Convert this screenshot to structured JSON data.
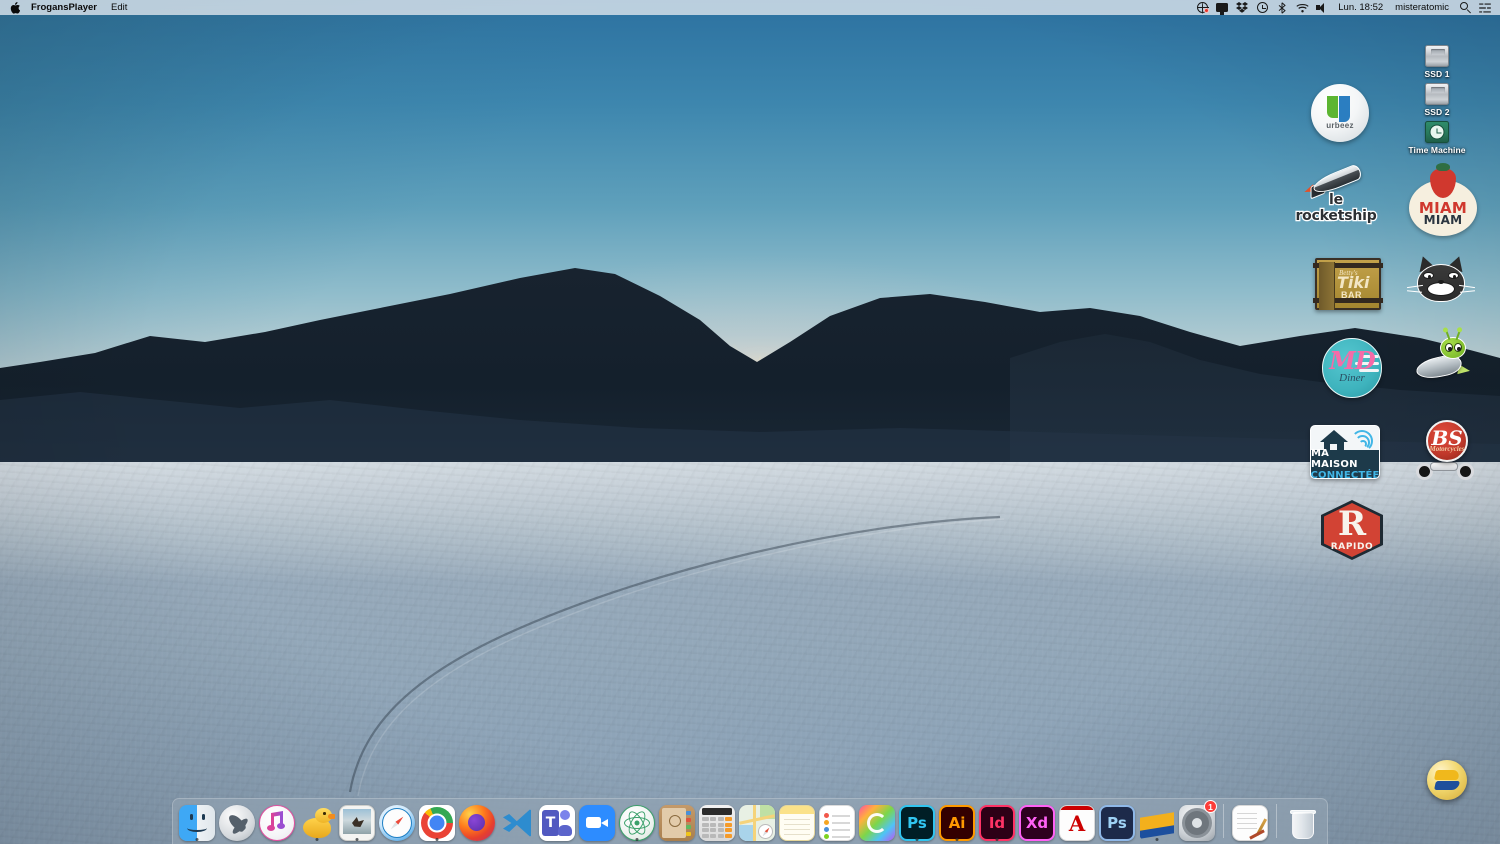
{
  "menubar": {
    "apple_icon": "apple-logo-icon",
    "app_name": "FrogansPlayer",
    "menus": [
      "Edit"
    ],
    "status_icons": [
      {
        "name": "screen-record-icon",
        "type": "globe-record"
      },
      {
        "name": "display-icon",
        "type": "display"
      },
      {
        "name": "dropbox-icon",
        "type": "dropbox"
      },
      {
        "name": "time-machine-icon",
        "type": "clock"
      },
      {
        "name": "bluetooth-icon",
        "type": "bluetooth"
      },
      {
        "name": "wifi-icon",
        "type": "wifi"
      },
      {
        "name": "volume-icon",
        "type": "volume"
      }
    ],
    "clock": "Lun. 18:52",
    "user": "misteratomic",
    "search_icon": "spotlight-search-icon",
    "control_center_icon": "control-center-icon"
  },
  "desktop": {
    "drives": [
      {
        "label": "SSD 1",
        "icon": "hard-drive-icon",
        "kind": "disk"
      },
      {
        "label": "SSD 2",
        "icon": "hard-drive-icon",
        "kind": "disk"
      },
      {
        "label": "Time Machine",
        "icon": "time-machine-disk-icon",
        "kind": "timemachine"
      }
    ],
    "frogans_sites": [
      {
        "name": "urbeez",
        "label": "urbeez"
      },
      {
        "name": "le-rocketship",
        "label": "le rocketship"
      },
      {
        "name": "miam-miam",
        "label_1": "MIAM",
        "label_2": "MIAM"
      },
      {
        "name": "bettys-tiki-bar",
        "label_1": "Betty's",
        "label_2": "Tiki",
        "label_3": "BAR"
      },
      {
        "name": "cat-face",
        "label": ""
      },
      {
        "name": "md-diner",
        "label_1": "MD",
        "label_2": "Diner"
      },
      {
        "name": "alien-rocket",
        "label": ""
      },
      {
        "name": "ma-maison-connectee",
        "label_1": "MA MAISON",
        "label_2": "CONNECTÉE"
      },
      {
        "name": "bs-motorcycles",
        "label_1": "BS",
        "label_2": "Motorcycles"
      },
      {
        "name": "rapido",
        "label_1": "R",
        "label_2": "RAPIDO"
      }
    ],
    "floating_frogans_icon": "frogans-player-icon"
  },
  "dock": {
    "items": [
      {
        "name": "finder",
        "label": "Finder",
        "running": true
      },
      {
        "name": "launchpad",
        "label": "Launchpad",
        "running": false
      },
      {
        "name": "itunes",
        "label": "iTunes",
        "running": false
      },
      {
        "name": "sequel-pro",
        "label": "Sequel Pro",
        "running": true
      },
      {
        "name": "preview",
        "label": "Preview",
        "running": true
      },
      {
        "name": "safari",
        "label": "Safari",
        "running": false
      },
      {
        "name": "google-chrome",
        "label": "Google Chrome",
        "running": true
      },
      {
        "name": "firefox",
        "label": "Firefox",
        "running": false
      },
      {
        "name": "visual-studio-code",
        "label": "Visual Studio Code",
        "running": false
      },
      {
        "name": "microsoft-teams",
        "label": "Microsoft Teams",
        "running": false
      },
      {
        "name": "zoom",
        "label": "Zoom",
        "running": false
      },
      {
        "name": "atom",
        "label": "Atom",
        "running": true
      },
      {
        "name": "contacts",
        "label": "Contacts",
        "running": false
      },
      {
        "name": "calculator",
        "label": "Calculator",
        "running": false
      },
      {
        "name": "maps",
        "label": "Maps",
        "running": false
      },
      {
        "name": "notes",
        "label": "Notes",
        "running": false
      },
      {
        "name": "reminders",
        "label": "Reminders",
        "running": false
      },
      {
        "name": "adobe-creative-cloud",
        "label": "Adobe Creative Cloud",
        "running": false
      },
      {
        "name": "adobe-photoshop",
        "label": "Ps",
        "running": true
      },
      {
        "name": "adobe-illustrator",
        "label": "Ai",
        "running": true
      },
      {
        "name": "adobe-indesign",
        "label": "Id",
        "running": true
      },
      {
        "name": "adobe-xd",
        "label": "Xd",
        "running": false
      },
      {
        "name": "adobe-acrobat",
        "label": "Acrobat",
        "running": false
      },
      {
        "name": "adobe-photoshop-cs",
        "label": "Ps",
        "running": false
      },
      {
        "name": "downloads-stack",
        "label": "Downloads",
        "running": false
      },
      {
        "name": "system-preferences",
        "label": "System Preferences",
        "running": false,
        "badge": "1"
      },
      {
        "name": "documents-stack",
        "label": "Documents",
        "running": false
      },
      {
        "name": "trash",
        "label": "Trash",
        "running": false
      }
    ],
    "separator_count": 2
  },
  "colors": {
    "sky_top": "#2c71a0",
    "sky_bottom": "#f2e2da",
    "salt_flat": "#92a7b9",
    "mountain": "#16202c",
    "menubar_bg": "#dee6ed",
    "dock_bg": "#96a5b4",
    "accent_red": "#fc3d39"
  }
}
